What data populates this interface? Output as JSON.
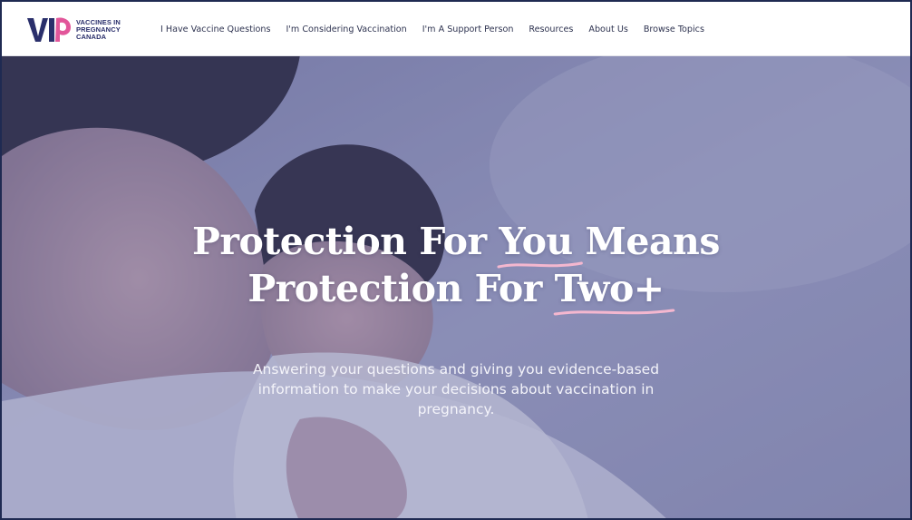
{
  "logo": {
    "line1": "VACCINES IN",
    "line2": "PREGNANCY",
    "line3": "CANADA"
  },
  "nav": {
    "items": [
      "I Have Vaccine Questions",
      "I'm Considering Vaccination",
      "I'm A Support Person",
      "Resources",
      "About Us",
      "Browse Topics"
    ]
  },
  "hero": {
    "headline_line1_a": "Protection For ",
    "headline_line1_highlight": "You",
    "headline_line1_b": " Means",
    "headline_line2_a": "Protection For ",
    "headline_line2_highlight": "Two+",
    "subtext_line1": "Answering your questions and giving you evidence-based",
    "subtext_line2": "information to make your decisions about vaccination in",
    "subtext_line3": "pregnancy."
  },
  "colors": {
    "brand_navy": "#2a2f6b",
    "brand_pink": "#e2569a",
    "underline_pink": "#f4b7cf",
    "hero_tint": "#4c528c"
  }
}
